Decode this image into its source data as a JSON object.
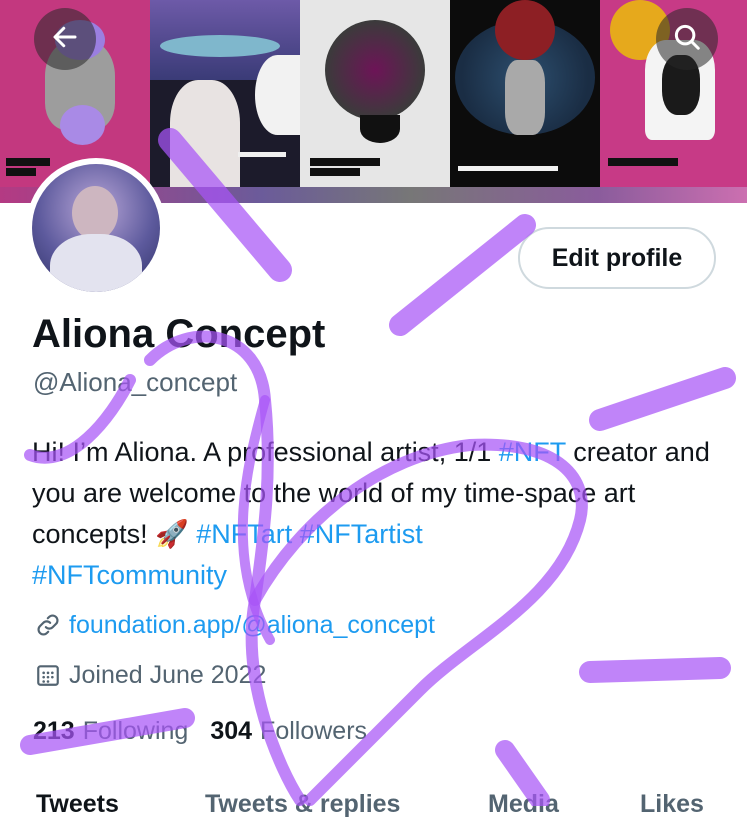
{
  "profile": {
    "name": "Aliona Concept",
    "handle": "@Aliona_concept",
    "bio": {
      "part1": "Hi! I’m Aliona. A professional artist, 1/1 ",
      "tag1": "#NFT",
      "part2": " creator and you are welcome to the world of my time-space art concepts! 🚀 ",
      "tag2": "#NFTart",
      "tag3": "#NFTartist",
      "tag4": "#NFTcommunity"
    },
    "website": "foundation.app/@aliona_concept",
    "joined": "Joined June 2022",
    "following_count": "213",
    "following_label": "Following",
    "followers_count": "304",
    "followers_label": "Followers"
  },
  "actions": {
    "edit_profile": "Edit profile"
  },
  "tabs": [
    "Tweets",
    "Tweets & replies",
    "Media",
    "Likes"
  ],
  "icons": {
    "back": "arrow-left-icon",
    "search": "search-icon",
    "link": "link-icon",
    "calendar": "calendar-icon"
  },
  "colors": {
    "accent": "#1d9bf0",
    "secondary_text": "#536471",
    "scribble": "#a855f7"
  }
}
